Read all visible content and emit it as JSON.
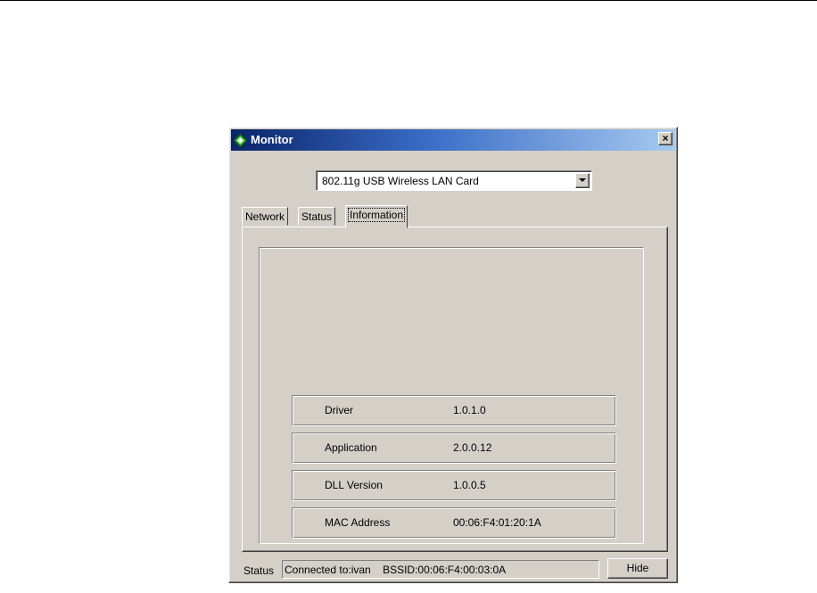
{
  "window": {
    "title": "Monitor",
    "close_glyph": "×",
    "icon": "diamond-app-icon"
  },
  "adapter": {
    "selected": "802.11g USB Wireless LAN Card"
  },
  "tabs": [
    {
      "label": "Network",
      "active": false
    },
    {
      "label": "Status",
      "active": false
    },
    {
      "label": "Information",
      "active": true
    }
  ],
  "information": {
    "rows": [
      {
        "label": "Driver",
        "value": "1.0.1.0"
      },
      {
        "label": "Application",
        "value": "2.0.0.12"
      },
      {
        "label": "DLL Version",
        "value": "1.0.0.5"
      },
      {
        "label": "MAC Address",
        "value": "00:06:F4:01:20:1A"
      }
    ]
  },
  "status_bar": {
    "label": "Status",
    "text": "Connected to:ivan    BSSID:00:06:F4:00:03:0A",
    "hide_label": "Hide"
  },
  "colors": {
    "face": "#d4d0c8",
    "title_start": "#0a246a",
    "title_end": "#a6caf0"
  }
}
